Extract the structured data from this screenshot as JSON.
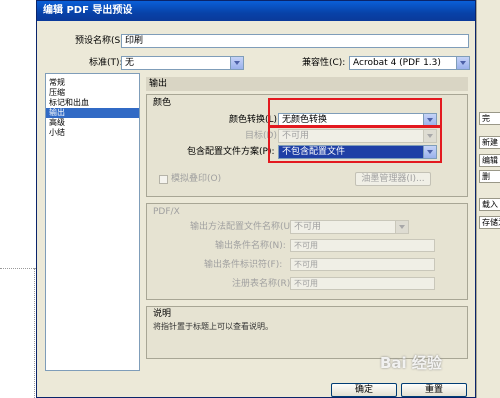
{
  "dialog": {
    "title": "编辑 PDF 导出预设",
    "preset_name_label": "预设名称(S):",
    "preset_name_value": "印刷",
    "standard_label": "标准(T):",
    "standard_value": "无",
    "compat_label": "兼容性(C):",
    "compat_value": "Acrobat 4 (PDF 1.3)"
  },
  "sidebar": {
    "items": [
      {
        "label": "常规"
      },
      {
        "label": "压缩"
      },
      {
        "label": "标记和出血"
      },
      {
        "label": "输出"
      },
      {
        "label": "高级"
      },
      {
        "label": "小结"
      }
    ]
  },
  "output": {
    "heading": "输出",
    "color_group_title": "颜色",
    "color_conversion_label": "颜色转换(L):",
    "color_conversion_value": "无颜色转换",
    "destination_label": "目标(D):",
    "destination_value": "不可用",
    "profile_policy_label": "包含配置文件方案(P):",
    "profile_policy_value": "不包含配置文件",
    "simulate_overprint_label": "模拟叠印(O)",
    "ink_manager_label": "油墨管理器(I)...",
    "pdfx_group_title": "PDF/X",
    "output_intent_label": "输出方法配置文件名称(U):",
    "output_intent_value": "不可用",
    "output_condition_name_label": "输出条件名称(N):",
    "output_condition_name_value": "不可用",
    "output_condition_id_label": "输出条件标识符(F):",
    "output_condition_id_value": "不可用",
    "registry_name_label": "注册表名称(R):",
    "registry_name_value": "不可用",
    "description_group_title": "说明",
    "description_text": "将指针置于标题上可以查看说明。"
  },
  "buttons": {
    "ok_label": "确定",
    "reset_label": "重置"
  },
  "right_panel": {
    "items": [
      {
        "label": "完"
      },
      {
        "label": "新建"
      },
      {
        "label": "编辑"
      },
      {
        "label": "删"
      },
      {
        "label": "载入"
      },
      {
        "label": "存储为"
      }
    ]
  },
  "watermark": {
    "text": "Bai 经验"
  },
  "colors": {
    "title_blue": "#0a4bc2",
    "dialog_bg": "#ece9d8",
    "highlight": "#e3191f",
    "selection": "#316ac5"
  }
}
